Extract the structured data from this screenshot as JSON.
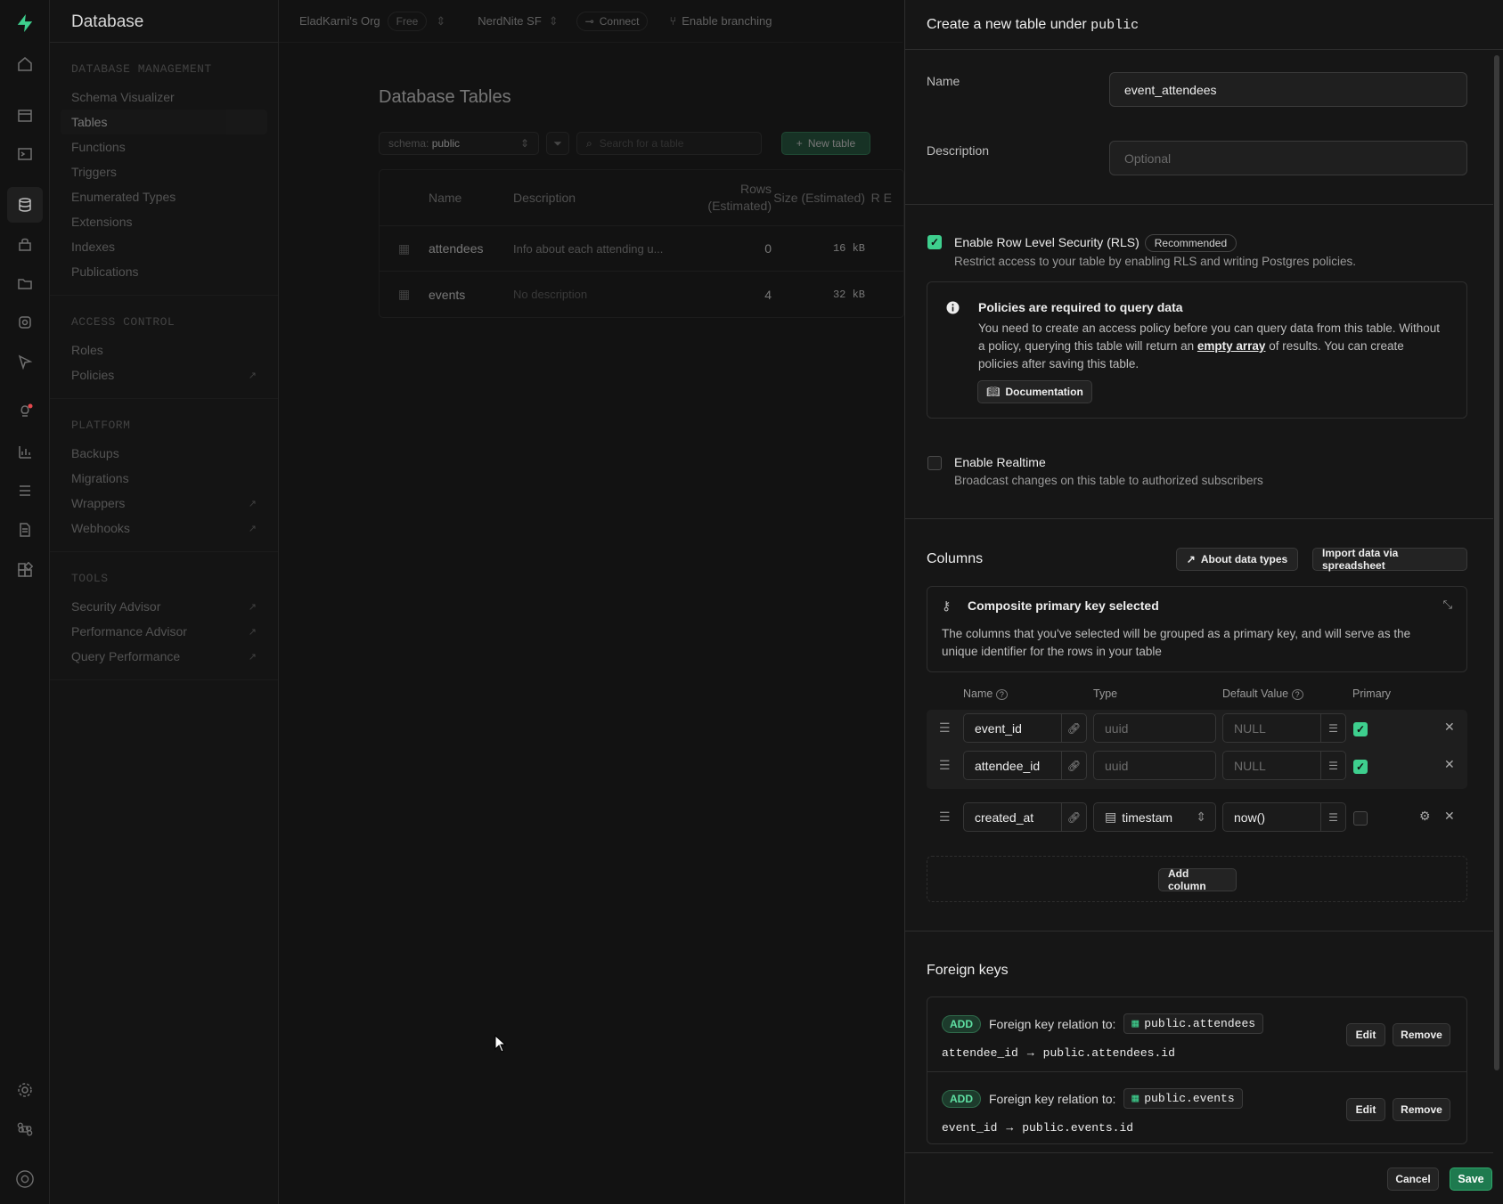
{
  "rail": {
    "icons": [
      "logo-icon",
      "home-icon",
      "table-editor-icon",
      "sql-editor-icon",
      "database-icon",
      "auth-icon",
      "storage-icon",
      "edge-functions-icon",
      "realtime-icon",
      "advisors-icon",
      "reports-icon",
      "logs-icon",
      "api-docs-icon",
      "integrations-icon",
      "settings-icon",
      "command-icon",
      "user-icon"
    ]
  },
  "sidebar": {
    "title": "Database",
    "sections": [
      {
        "title": "Database Management",
        "items": [
          {
            "label": "Schema Visualizer"
          },
          {
            "label": "Tables",
            "active": true
          },
          {
            "label": "Functions"
          },
          {
            "label": "Triggers"
          },
          {
            "label": "Enumerated Types"
          },
          {
            "label": "Extensions"
          },
          {
            "label": "Indexes"
          },
          {
            "label": "Publications"
          }
        ]
      },
      {
        "title": "Access Control",
        "items": [
          {
            "label": "Roles"
          },
          {
            "label": "Policies",
            "external": true
          }
        ]
      },
      {
        "title": "Platform",
        "items": [
          {
            "label": "Backups"
          },
          {
            "label": "Migrations"
          },
          {
            "label": "Wrappers",
            "external": true
          },
          {
            "label": "Webhooks",
            "external": true
          }
        ]
      },
      {
        "title": "Tools",
        "items": [
          {
            "label": "Security Advisor",
            "external": true
          },
          {
            "label": "Performance Advisor",
            "external": true
          },
          {
            "label": "Query Performance",
            "external": true
          }
        ]
      }
    ]
  },
  "topbar": {
    "org": "EladKarni's Org",
    "plan": "Free",
    "project": "NerdNite SF",
    "connect": "Connect",
    "branching": "Enable branching"
  },
  "main": {
    "title": "Database Tables",
    "schema_prefix": "schema:",
    "schema_value": "public",
    "search_placeholder": "Search for a table",
    "new_table": "New table",
    "headers": {
      "name": "Name",
      "description": "Description",
      "rows": "Rows (Estimated)",
      "size": "Size (Estimated)",
      "r": "R E"
    },
    "rows": [
      {
        "name": "attendees",
        "description": "Info about each attending u...",
        "rows": "0",
        "size": "16 kB"
      },
      {
        "name": "events",
        "description": "No description",
        "rows": "4",
        "size": "32 kB"
      }
    ]
  },
  "panel": {
    "title": "Create a new table under",
    "schema": "public",
    "name_label": "Name",
    "name_value": "event_attendees",
    "description_label": "Description",
    "description_placeholder": "Optional",
    "rls_label": "Enable Row Level Security (RLS)",
    "rls_badge": "Recommended",
    "rls_enabled": true,
    "rls_help": "Restrict access to your table by enabling RLS and writing Postgres policies.",
    "policy_title": "Policies are required to query data",
    "policy_text_1": "You need to create an access policy before you can query data from this table. Without a policy, querying this table will return an",
    "policy_link": "empty array",
    "policy_text_2": "of results. You can create policies after saving this table.",
    "documentation": "Documentation",
    "realtime_label": "Enable Realtime",
    "realtime_enabled": false,
    "realtime_help": "Broadcast changes on this table to authorized subscribers",
    "columns_title": "Columns",
    "about_types": "About data types",
    "import_data": "Import data via spreadsheet",
    "composite_title": "Composite primary key selected",
    "composite_text": "The columns that you've selected will be grouped as a primary key, and will serve as the unique identifier for the rows in your table",
    "col_headers": {
      "name": "Name",
      "type": "Type",
      "default": "Default Value",
      "primary": "Primary"
    },
    "columns": [
      {
        "name": "event_id",
        "type": "uuid",
        "default": "NULL",
        "primary": true
      },
      {
        "name": "attendee_id",
        "type": "uuid",
        "default": "NULL",
        "primary": true
      },
      {
        "name": "created_at",
        "type": "timestam",
        "default": "now()",
        "primary": false
      }
    ],
    "add_column": "Add column",
    "fk_title": "Foreign keys",
    "foreign_keys": [
      {
        "tag": "ADD",
        "label": "Foreign key relation to:",
        "table": "public.attendees",
        "from": "attendee_id",
        "to": "public.attendees.id",
        "edit": "Edit",
        "remove": "Remove"
      },
      {
        "tag": "ADD",
        "label": "Foreign key relation to:",
        "table": "public.events",
        "from": "event_id",
        "to": "public.events.id",
        "edit": "Edit",
        "remove": "Remove"
      }
    ],
    "cancel": "Cancel",
    "save": "Save"
  },
  "colors": {
    "accent": "#3ecf8e",
    "panel_bg": "#161616",
    "app_bg": "#121212"
  }
}
